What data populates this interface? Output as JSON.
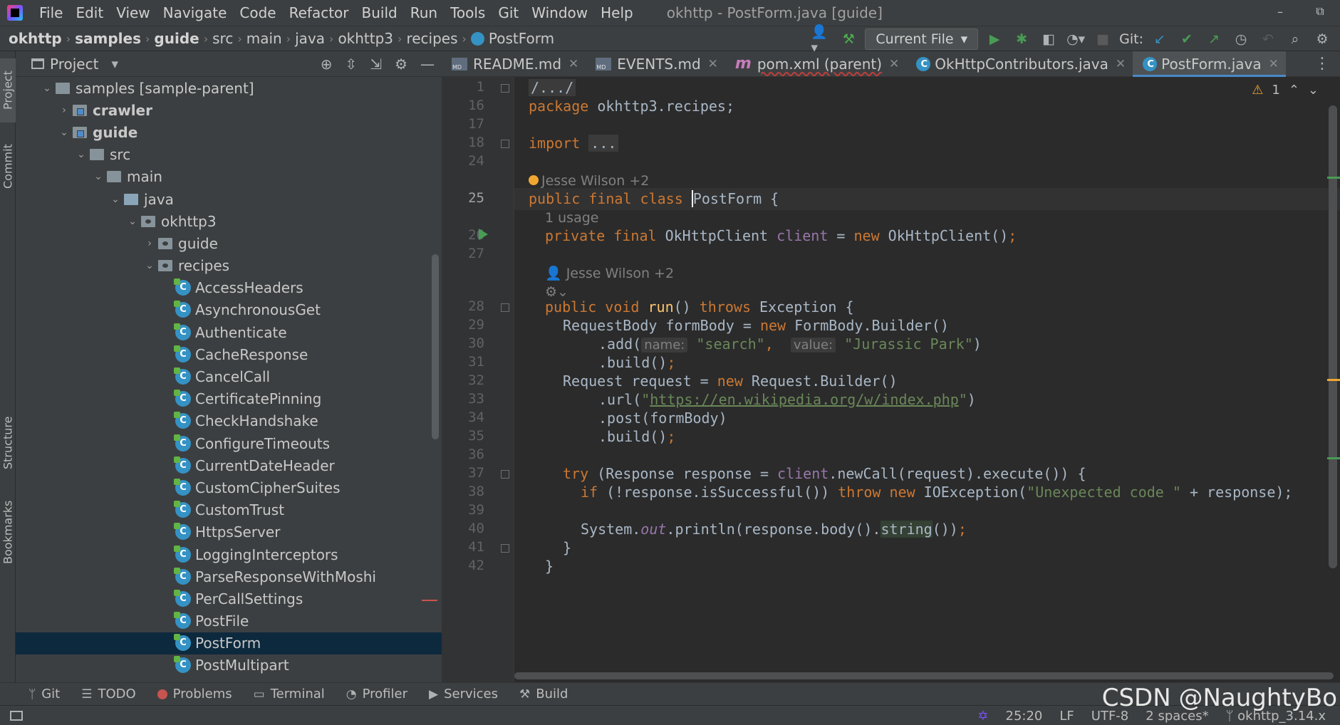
{
  "menu": {
    "items": [
      "File",
      "Edit",
      "View",
      "Navigate",
      "Code",
      "Refactor",
      "Build",
      "Run",
      "Tools",
      "Git",
      "Window",
      "Help"
    ],
    "title": "okhttp - PostForm.java [guide]"
  },
  "window_controls": {
    "minimize": "–",
    "restore": "⧉"
  },
  "navbar": {
    "crumbs": [
      "okhttp",
      "samples",
      "guide",
      "src",
      "main",
      "java",
      "okhttp3",
      "recipes",
      "PostForm"
    ],
    "run_config": "Current File",
    "git_label": "Git:"
  },
  "left_strip": {
    "project": "Project",
    "commit": "Commit",
    "structure": "Structure",
    "bookmarks": "Bookmarks"
  },
  "project_panel": {
    "title": "Project",
    "tree": [
      {
        "label": "samples [sample-parent]",
        "depth": 0,
        "arrow": "down",
        "icon": "folder",
        "bold": false
      },
      {
        "label": "crawler",
        "depth": 1,
        "arrow": "right",
        "icon": "module-folder",
        "bold": true
      },
      {
        "label": "guide",
        "depth": 1,
        "arrow": "down",
        "icon": "module-folder",
        "bold": true
      },
      {
        "label": "src",
        "depth": 2,
        "arrow": "down",
        "icon": "folder",
        "bold": false
      },
      {
        "label": "main",
        "depth": 3,
        "arrow": "down",
        "icon": "folder",
        "bold": false
      },
      {
        "label": "java",
        "depth": 4,
        "arrow": "down",
        "icon": "source-folder",
        "bold": false
      },
      {
        "label": "okhttp3",
        "depth": 5,
        "arrow": "down",
        "icon": "package",
        "bold": false
      },
      {
        "label": "guide",
        "depth": 6,
        "arrow": "right",
        "icon": "package",
        "bold": false
      },
      {
        "label": "recipes",
        "depth": 6,
        "arrow": "down",
        "icon": "package",
        "bold": false
      },
      {
        "label": "AccessHeaders",
        "depth": 7,
        "icon": "class"
      },
      {
        "label": "AsynchronousGet",
        "depth": 7,
        "icon": "class"
      },
      {
        "label": "Authenticate",
        "depth": 7,
        "icon": "class"
      },
      {
        "label": "CacheResponse",
        "depth": 7,
        "icon": "class"
      },
      {
        "label": "CancelCall",
        "depth": 7,
        "icon": "class"
      },
      {
        "label": "CertificatePinning",
        "depth": 7,
        "icon": "class"
      },
      {
        "label": "CheckHandshake",
        "depth": 7,
        "icon": "class"
      },
      {
        "label": "ConfigureTimeouts",
        "depth": 7,
        "icon": "class"
      },
      {
        "label": "CurrentDateHeader",
        "depth": 7,
        "icon": "class"
      },
      {
        "label": "CustomCipherSuites",
        "depth": 7,
        "icon": "class"
      },
      {
        "label": "CustomTrust",
        "depth": 7,
        "icon": "class"
      },
      {
        "label": "HttpsServer",
        "depth": 7,
        "icon": "class"
      },
      {
        "label": "LoggingInterceptors",
        "depth": 7,
        "icon": "class"
      },
      {
        "label": "ParseResponseWithMoshi",
        "depth": 7,
        "icon": "class"
      },
      {
        "label": "PerCallSettings",
        "depth": 7,
        "icon": "class"
      },
      {
        "label": "PostFile",
        "depth": 7,
        "icon": "class"
      },
      {
        "label": "PostForm",
        "depth": 7,
        "icon": "class",
        "selected": true
      },
      {
        "label": "PostMultipart",
        "depth": 7,
        "icon": "class"
      }
    ]
  },
  "editor_tabs": [
    {
      "label": "README.md",
      "icon": "md-icon",
      "active": false
    },
    {
      "label": "EVENTS.md",
      "icon": "md-icon",
      "active": false
    },
    {
      "label": "pom.xml (parent)",
      "icon": "maven-icon",
      "active": false
    },
    {
      "label": "OkHttpContributors.java",
      "icon": "class-icon",
      "active": false
    },
    {
      "label": "PostForm.java",
      "icon": "class-icon",
      "active": true
    }
  ],
  "editor": {
    "warnings_count": "1",
    "cursor_position": "25:20",
    "author_hint_1": "Jesse Wilson +2",
    "author_hint_2": "Jesse Wilson +2",
    "usages": "1 usage",
    "line_numbers": [
      "1",
      "16",
      "17",
      "18",
      "24",
      "25",
      "26",
      "27",
      "28",
      "29",
      "30",
      "31",
      "32",
      "33",
      "34",
      "35",
      "36",
      "37",
      "38",
      "39",
      "40",
      "41",
      "42"
    ],
    "code": {
      "l1": "/.../",
      "l16_kw": "package",
      "l16_rest": " okhttp3.recipes;",
      "l18_kw": "import",
      "l18_fold": "...",
      "l25_kw": "public final class",
      "l25_name": "PostForm",
      "l25_rest": " {",
      "l26_kw": "private final",
      "l26_type": " OkHttpClient ",
      "l26_field": "client",
      "l26_eq": " = ",
      "l26_new": "new",
      "l26_rest": " OkHttpClient()",
      "l26_semi": ";",
      "l28_kw1": "public void",
      "l28_fn": "run",
      "l28_mid": "() ",
      "l28_kw2": "throws",
      "l28_rest": " Exception {",
      "l29_a": "RequestBody formBody = ",
      "l29_new": "new",
      "l29_b": " FormBody.Builder()",
      "l30_a": ".add(",
      "l30_hint1": "name:",
      "l30_s1": "\"search\"",
      "l30_comma": ",",
      "l30_hint2": "value:",
      "l30_s2": "\"Jurassic Park\"",
      "l30_b": ")",
      "l31": ".build()",
      "l31_semi": ";",
      "l32_a": "Request request = ",
      "l32_new": "new",
      "l32_b": " Request.Builder()",
      "l33_a": ".url(",
      "l33_q1": "\"",
      "l33_url": "https://en.wikipedia.org/w/index.php",
      "l33_q2": "\"",
      "l33_b": ")",
      "l34": ".post(formBody)",
      "l35": ".build()",
      "l35_semi": ";",
      "l37_kw": "try",
      "l37_a": " (Response response = ",
      "l37_field": "client",
      "l37_b": ".newCall(request).execute()) {",
      "l38_kw": "if",
      "l38_a": " (!response.isSuccessful()) ",
      "l38_kw2": "throw new",
      "l38_b": " IOException(",
      "l38_str": "\"Unexpected code \"",
      "l38_c": " + response);",
      "l40_a": "System.",
      "l40_out": "out",
      "l40_b": ".println(response.body().",
      "l40_str": "string",
      "l40_c": "())",
      "l40_semi": ";",
      "l41": "}",
      "l42": "}"
    }
  },
  "bottom_tools": [
    "Git",
    "TODO",
    "Problems",
    "Terminal",
    "Profiler",
    "Services",
    "Build"
  ],
  "status_bar": {
    "position": "25:20",
    "line_sep": "LF",
    "encoding": "UTF-8",
    "indent": "2 spaces*",
    "branch": "okhttp_3.14.x"
  },
  "watermark": "CSDN @NaughtyBo",
  "colors": {
    "keyword": "#cc7832",
    "string": "#6a8759",
    "field": "#9876aa",
    "method": "#ffc66d",
    "accent": "#4a88c7"
  }
}
